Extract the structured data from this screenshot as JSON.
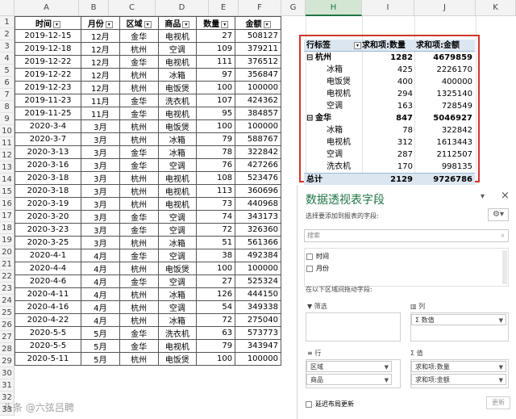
{
  "columns": [
    "A",
    "B",
    "C",
    "D",
    "E",
    "F",
    "G",
    "H",
    "I",
    "J",
    "K"
  ],
  "rows": [
    "1",
    "2",
    "3",
    "4",
    "5",
    "6",
    "7",
    "8",
    "9",
    "10",
    "11",
    "12",
    "13",
    "14",
    "15",
    "16",
    "17",
    "18",
    "19",
    "20",
    "21",
    "22",
    "23",
    "24",
    "25",
    "26",
    "27",
    "28",
    "29",
    "30",
    "31",
    "32",
    "33"
  ],
  "source_table": {
    "headers": [
      "时间",
      "月份",
      "区域",
      "商品",
      "数量",
      "金额"
    ],
    "rows": [
      [
        "2019-12-15",
        "12月",
        "金华",
        "电视机",
        "27",
        "508127"
      ],
      [
        "2019-12-18",
        "12月",
        "杭州",
        "空调",
        "109",
        "379211"
      ],
      [
        "2019-12-22",
        "12月",
        "金华",
        "电视机",
        "111",
        "376512"
      ],
      [
        "2019-12-22",
        "12月",
        "杭州",
        "冰箱",
        "97",
        "356847"
      ],
      [
        "2019-12-23",
        "12月",
        "杭州",
        "电饭煲",
        "100",
        "100000"
      ],
      [
        "2019-11-23",
        "11月",
        "金华",
        "洗衣机",
        "107",
        "424362"
      ],
      [
        "2019-11-25",
        "11月",
        "金华",
        "电视机",
        "95",
        "384857"
      ],
      [
        "2020-3-4",
        "3月",
        "杭州",
        "电饭煲",
        "100",
        "100000"
      ],
      [
        "2020-3-7",
        "3月",
        "杭州",
        "冰箱",
        "79",
        "588767"
      ],
      [
        "2020-3-13",
        "3月",
        "金华",
        "冰箱",
        "78",
        "322842"
      ],
      [
        "2020-3-16",
        "3月",
        "金华",
        "空调",
        "76",
        "427266"
      ],
      [
        "2020-3-18",
        "3月",
        "杭州",
        "电视机",
        "108",
        "523476"
      ],
      [
        "2020-3-18",
        "3月",
        "杭州",
        "电视机",
        "113",
        "360696"
      ],
      [
        "2020-3-19",
        "3月",
        "杭州",
        "电视机",
        "73",
        "440968"
      ],
      [
        "2020-3-20",
        "3月",
        "金华",
        "空调",
        "74",
        "343173"
      ],
      [
        "2020-3-23",
        "3月",
        "金华",
        "空调",
        "72",
        "326360"
      ],
      [
        "2020-3-25",
        "3月",
        "杭州",
        "冰箱",
        "51",
        "561366"
      ],
      [
        "2020-4-1",
        "4月",
        "金华",
        "空调",
        "38",
        "492384"
      ],
      [
        "2020-4-4",
        "4月",
        "杭州",
        "电饭煲",
        "100",
        "100000"
      ],
      [
        "2020-4-6",
        "4月",
        "金华",
        "空调",
        "27",
        "525324"
      ],
      [
        "2020-4-11",
        "4月",
        "杭州",
        "冰箱",
        "126",
        "444150"
      ],
      [
        "2020-4-16",
        "4月",
        "杭州",
        "空调",
        "54",
        "349338"
      ],
      [
        "2020-4-22",
        "4月",
        "杭州",
        "冰箱",
        "72",
        "275040"
      ],
      [
        "2020-5-5",
        "5月",
        "金华",
        "洗衣机",
        "63",
        "573773"
      ],
      [
        "2020-5-5",
        "5月",
        "金华",
        "电视机",
        "79",
        "343947"
      ],
      [
        "2020-5-11",
        "5月",
        "杭州",
        "电饭煲",
        "100",
        "100000"
      ]
    ]
  },
  "pivot": {
    "header_row_label": "行标签",
    "header_qty": "求和项:数量",
    "header_amt": "求和项:金额",
    "groups": [
      {
        "name": "杭州",
        "toggle": "⊟",
        "qty": "1282",
        "amt": "4679859",
        "items": [
          [
            "冰箱",
            "425",
            "2226170"
          ],
          [
            "电饭煲",
            "400",
            "400000"
          ],
          [
            "电视机",
            "294",
            "1325140"
          ],
          [
            "空调",
            "163",
            "728549"
          ]
        ]
      },
      {
        "name": "金华",
        "toggle": "⊟",
        "qty": "847",
        "amt": "5046927",
        "items": [
          [
            "冰箱",
            "78",
            "322842"
          ],
          [
            "电视机",
            "312",
            "1613443"
          ],
          [
            "空调",
            "287",
            "2112507"
          ],
          [
            "洗衣机",
            "170",
            "998135"
          ]
        ]
      }
    ],
    "total_label": "总计",
    "total_qty": "2129",
    "total_amt": "9726786"
  },
  "field_pane": {
    "title": "数据透视表字段",
    "subtitle": "选择要添加到报表的字段:",
    "search_placeholder": "搜索",
    "fields": [
      "时间",
      "月份"
    ],
    "drag_hint": "在以下区域间拖动字段:",
    "filter_label": "筛选",
    "columns_label": "列",
    "rows_label": "行",
    "values_label": "值",
    "column_items": [
      "Σ 数值"
    ],
    "row_items": [
      "区域",
      "商品"
    ],
    "value_items": [
      "求和项:数量",
      "求和项:金额"
    ],
    "defer_label": "延迟布局更新",
    "update_button": "更新",
    "close_icon": "×",
    "dropdown_icon": "▾"
  },
  "watermark": "头条 @六弦吕聘",
  "colors": {
    "accent": "#217346",
    "highlight": "#d0342c",
    "pivot_header": "#dce6f1"
  }
}
